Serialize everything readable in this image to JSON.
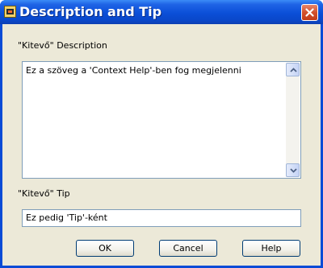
{
  "window": {
    "title": "Description and Tip",
    "app_icon": "labview-vi-icon",
    "close_icon": "close-icon"
  },
  "description": {
    "label": "\"Kitevő\" Description",
    "value": "Ez a szöveg a 'Context Help'-ben fog megjelenni"
  },
  "tip": {
    "label": "\"Kitevő\" Tip",
    "value": "Ez pedig 'Tip'-ként"
  },
  "buttons": {
    "ok": "OK",
    "cancel": "Cancel",
    "help": "Help"
  },
  "colors": {
    "titlebar": "#0b4fd8",
    "dialog_bg": "#ece9d8",
    "close_button": "#d2502c",
    "field_border": "#7f9db9"
  }
}
